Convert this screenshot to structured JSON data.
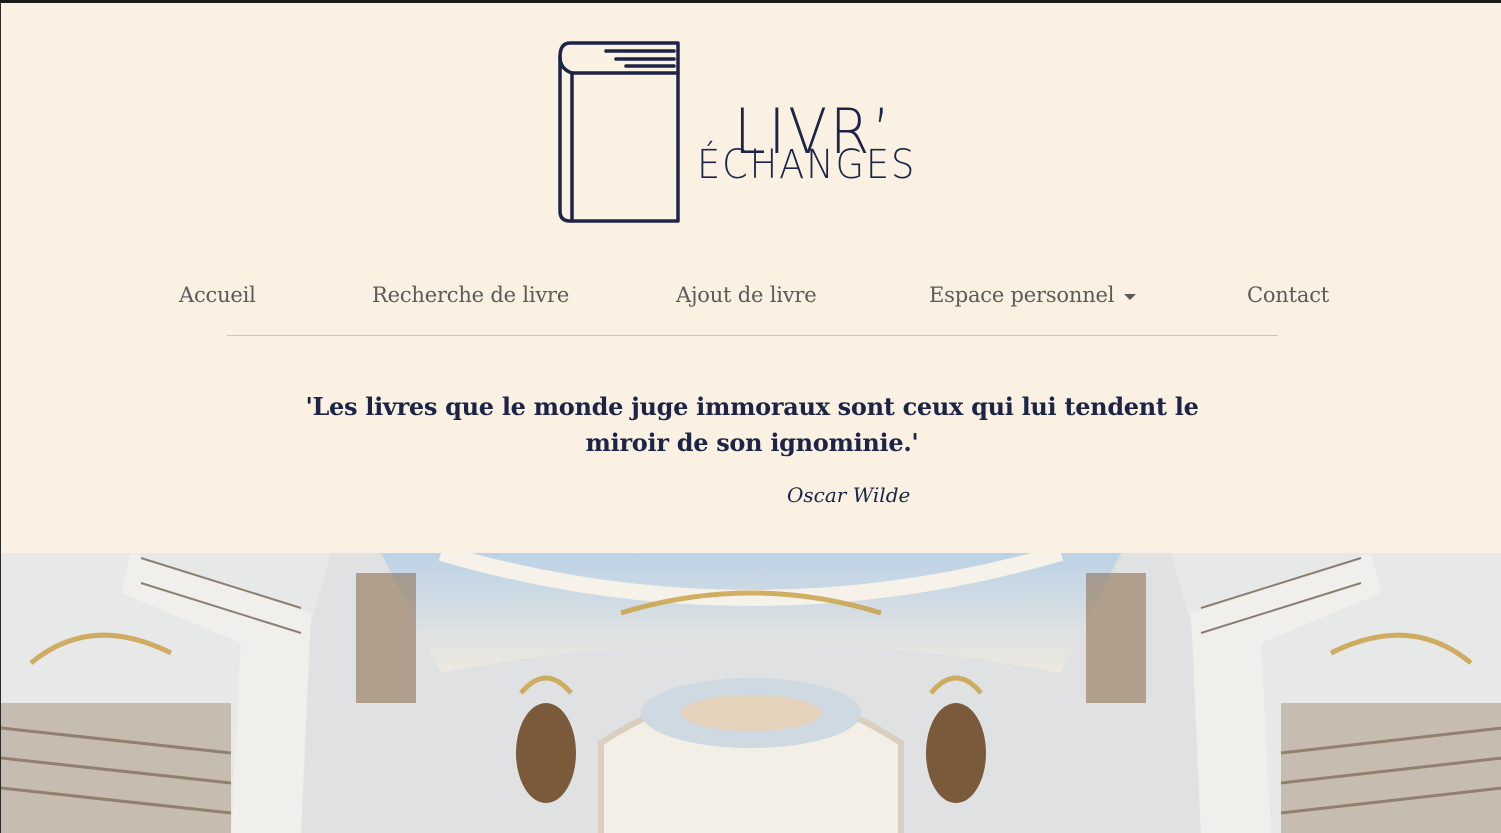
{
  "brand": {
    "line1": "LIVR’",
    "line2": "ÉCHANGES"
  },
  "nav": {
    "items": [
      {
        "label": "Accueil"
      },
      {
        "label": "Recherche de livre"
      },
      {
        "label": "Ajout de livre"
      },
      {
        "label": "Espace personnel",
        "dropdown": true
      },
      {
        "label": "Contact"
      }
    ]
  },
  "quote": {
    "text": "'Les livres que le monde juge immoraux sont ceux qui lui tendent le miroir de son ignominie.'",
    "author": "Oscar Wilde"
  },
  "colors": {
    "background": "#faf1e3",
    "brand_navy": "#1c2447",
    "nav_text": "#5a5a5a",
    "gold": "#c9a24a"
  },
  "hero": {
    "icon": "baroque-library-image"
  }
}
